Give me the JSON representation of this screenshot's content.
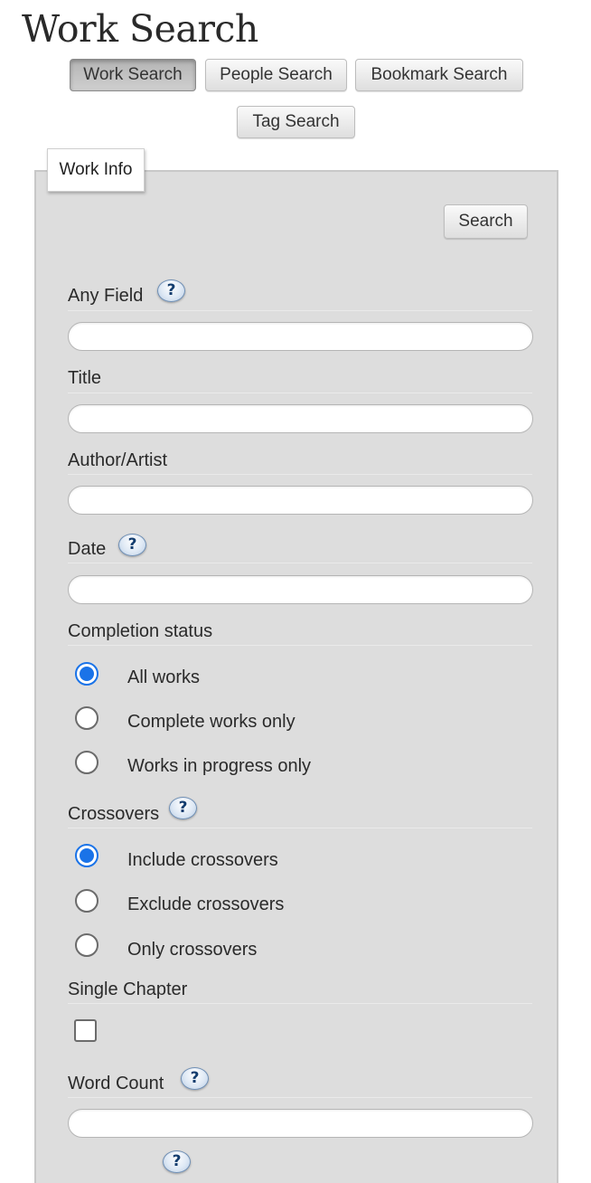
{
  "page": {
    "title": "Work Search"
  },
  "nav": {
    "tabs": [
      {
        "label": "Work Search",
        "active": true
      },
      {
        "label": "People Search",
        "active": false
      },
      {
        "label": "Bookmark Search",
        "active": false
      },
      {
        "label": "Tag Search",
        "active": false
      }
    ]
  },
  "form": {
    "legend": "Work Info",
    "search_button": "Search",
    "help_glyph": "?",
    "any_field": {
      "label": "Any Field",
      "value": "",
      "help_icon": "question-icon"
    },
    "title": {
      "label": "Title",
      "value": ""
    },
    "author": {
      "label": "Author/Artist",
      "value": ""
    },
    "date": {
      "label": "Date",
      "value": "",
      "help_icon": "question-icon"
    },
    "completion": {
      "label": "Completion status",
      "options": [
        {
          "label": "All works",
          "checked": true
        },
        {
          "label": "Complete works only",
          "checked": false
        },
        {
          "label": "Works in progress only",
          "checked": false
        }
      ]
    },
    "crossovers": {
      "label": "Crossovers",
      "help_icon": "question-icon",
      "options": [
        {
          "label": "Include crossovers",
          "checked": true
        },
        {
          "label": "Exclude crossovers",
          "checked": false
        },
        {
          "label": "Only crossovers",
          "checked": false
        }
      ]
    },
    "single_chapter": {
      "label": "Single Chapter",
      "checked": false
    },
    "word_count": {
      "label": "Word Count",
      "value": "",
      "help_icon": "question-icon"
    }
  },
  "colors": {
    "panel_background": "#dddddd",
    "radio_accent": "#1a73e8",
    "help_icon_border": "#6f8fb5"
  }
}
